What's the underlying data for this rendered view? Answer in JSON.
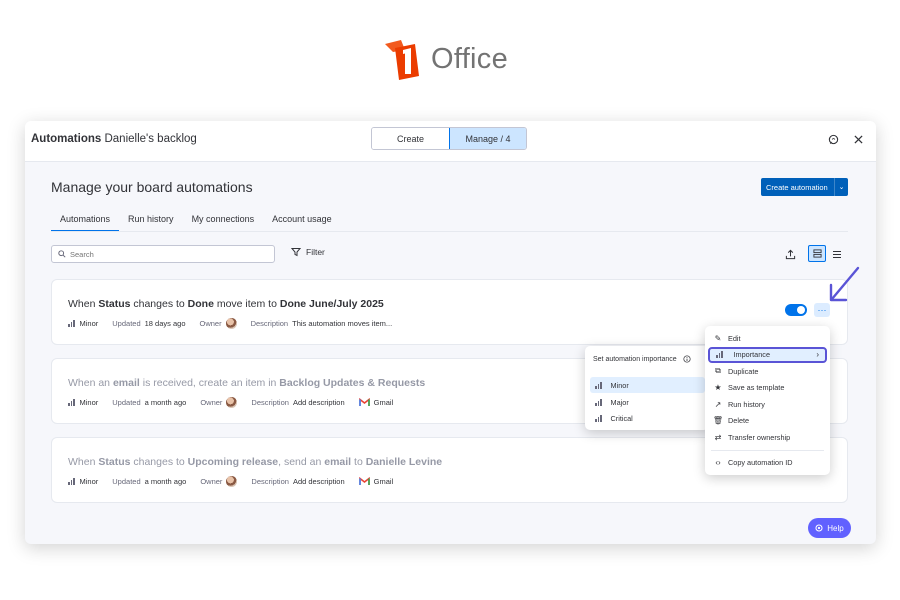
{
  "brand": {
    "name": "Office",
    "icon": "office-logo"
  },
  "topbar": {
    "title_bold": "Automations",
    "title_rest": "Danielle's backlog",
    "seg_create": "Create",
    "seg_manage": "Manage / 4",
    "icons": [
      "feedback-icon",
      "close-icon"
    ]
  },
  "header": {
    "page_title": "Manage your board automations",
    "create_button": "Create automation"
  },
  "tabs": [
    "Automations",
    "Run history",
    "My connections",
    "Account usage"
  ],
  "toolbar": {
    "search_placeholder": "Search",
    "filter_label": "Filter"
  },
  "cards": [
    {
      "t1": "When ",
      "b1": "Status",
      "t2": " changes to ",
      "b2": "Done",
      "t3": " move item to ",
      "b3": "Done June/July 2025",
      "t4": "",
      "importance": "Minor",
      "updated_label": "Updated",
      "updated_value": "18 days ago",
      "owner_label": "Owner",
      "desc_label": "Description",
      "desc_value": "This automation moves item...",
      "integration": "",
      "enabled": true
    },
    {
      "t1": "When an ",
      "b1": "email",
      "t2": " is received, create an item in ",
      "b2": "Backlog Updates & Requests",
      "t3": "",
      "b3": "",
      "t4": "",
      "importance": "Minor",
      "updated_label": "Updated",
      "updated_value": "a month ago",
      "owner_label": "Owner",
      "desc_label": "Description",
      "desc_value": "Add description",
      "integration": "Gmail",
      "enabled": false
    },
    {
      "t1": "When ",
      "b1": "Status",
      "t2": " changes to ",
      "b2": "Upcoming release",
      "t3": ", send an ",
      "b3": "email",
      "t4": " to ",
      "b4": "Danielle Levine",
      "importance": "Minor",
      "updated_label": "Updated",
      "updated_value": "a month ago",
      "owner_label": "Owner",
      "desc_label": "Description",
      "desc_value": "Add description",
      "integration": "Gmail",
      "enabled": false
    }
  ],
  "menu": {
    "items": [
      "Edit",
      "Importance",
      "Duplicate",
      "Save as template",
      "Run history",
      "Delete",
      "Transfer ownership"
    ],
    "footer": "Copy automation ID"
  },
  "submenu": {
    "title": "Set automation importance",
    "options": [
      "Minor",
      "Major",
      "Critical"
    ],
    "selected": "Minor"
  },
  "help": {
    "label": "Help"
  },
  "colors": {
    "accent": "#0073ea",
    "primary_button": "#0060b9",
    "highlight": "#5a54d6",
    "help": "#6161ff",
    "brand_orange": "#eb3c00"
  }
}
